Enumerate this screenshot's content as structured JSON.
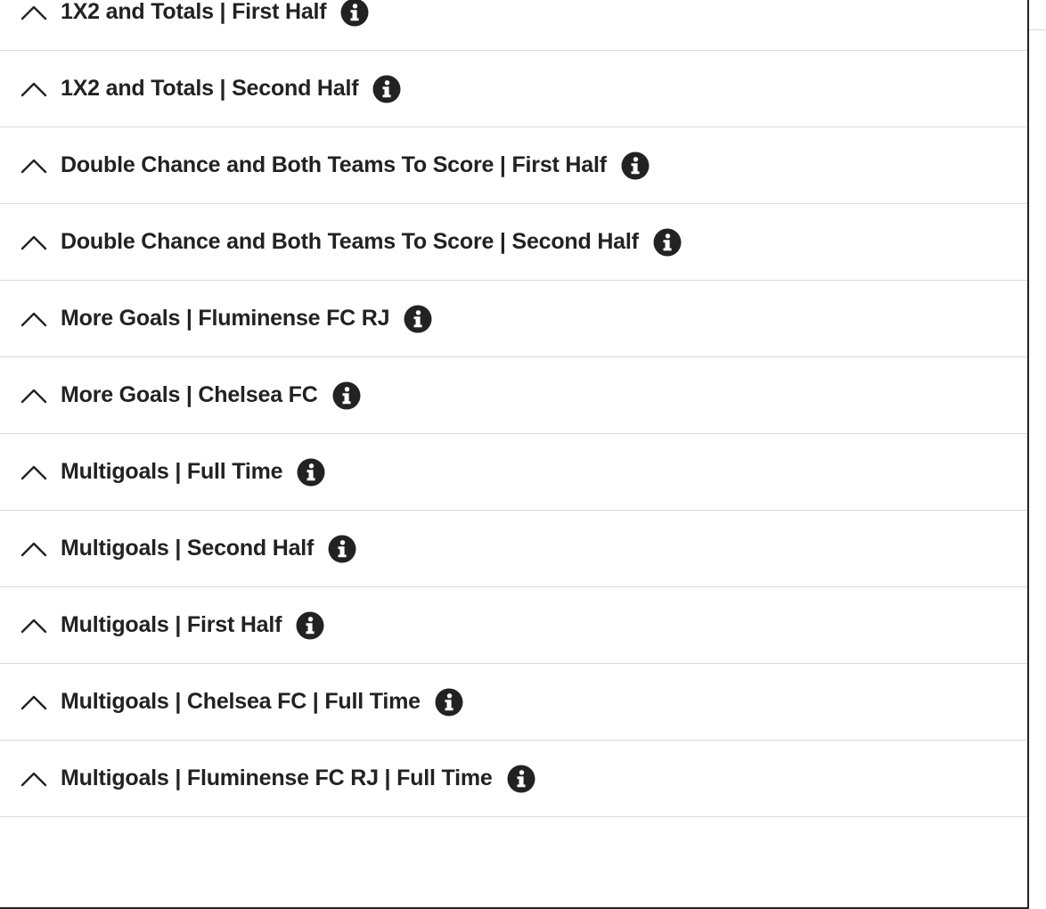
{
  "markets": [
    {
      "title": "1X2 and Totals | First Half",
      "expanded": true,
      "icon": "info-icon"
    },
    {
      "title": "1X2 and Totals | Second Half",
      "expanded": true,
      "icon": "info-icon"
    },
    {
      "title": "Double Chance and Both Teams To Score | First Half",
      "expanded": true,
      "icon": "info-icon"
    },
    {
      "title": "Double Chance and Both Teams To Score | Second Half",
      "expanded": true,
      "icon": "info-icon"
    },
    {
      "title": "More Goals | Fluminense FC RJ",
      "expanded": true,
      "icon": "info-icon"
    },
    {
      "title": "More Goals | Chelsea FC",
      "expanded": true,
      "icon": "info-icon"
    },
    {
      "title": "Multigoals | Full Time",
      "expanded": true,
      "icon": "info-icon"
    },
    {
      "title": "Multigoals | Second Half",
      "expanded": true,
      "icon": "info-icon"
    },
    {
      "title": "Multigoals | First Half",
      "expanded": true,
      "icon": "info-icon"
    },
    {
      "title": "Multigoals | Chelsea FC | Full Time",
      "expanded": true,
      "icon": "info-icon"
    },
    {
      "title": "Multigoals | Fluminense FC RJ | Full Time",
      "expanded": true,
      "icon": "info-icon"
    }
  ],
  "colors": {
    "text": "#222222",
    "divider": "#d9d9d9",
    "background": "#ffffff"
  }
}
